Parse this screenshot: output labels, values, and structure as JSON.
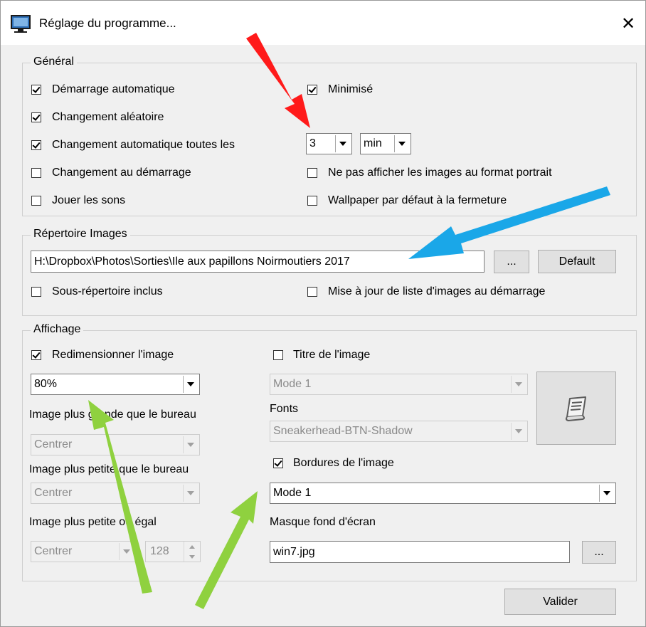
{
  "window": {
    "title": "Réglage du programme...",
    "icon": "monitor-icon",
    "close_glyph": "✕"
  },
  "general": {
    "legend": "Général",
    "auto_start": {
      "label": "Démarrage automatique",
      "checked": true
    },
    "minimized": {
      "label": "Minimisé",
      "checked": true
    },
    "random_change": {
      "label": "Changement aléatoire",
      "checked": true
    },
    "auto_change": {
      "label": "Changement automatique toutes les",
      "checked": true
    },
    "interval_value": "3",
    "interval_unit": "min",
    "change_on_start": {
      "label": "Changement au démarrage",
      "checked": false
    },
    "no_portrait": {
      "label": "Ne pas afficher les images au format portrait",
      "checked": false
    },
    "play_sounds": {
      "label": "Jouer les sons",
      "checked": false
    },
    "default_wallpaper": {
      "label": "Wallpaper par défaut à la fermeture",
      "checked": false
    }
  },
  "images_dir": {
    "legend": "Répertoire Images",
    "path": "H:\\Dropbox\\Photos\\Sorties\\Ile aux papillons Noirmoutiers 2017",
    "browse_label": "...",
    "default_label": "Default",
    "include_subdirs": {
      "label": "Sous-répertoire inclus",
      "checked": false
    },
    "refresh_on_start": {
      "label": "Mise à jour de liste d'images au démarrage",
      "checked": false
    }
  },
  "display": {
    "legend": "Affichage",
    "resize": {
      "label": "Redimensionner l'image",
      "checked": true
    },
    "resize_value": "80%",
    "larger_label": "Image plus grande que le bureau",
    "larger_value": "Centrer",
    "smaller_label": "Image plus petite que le bureau",
    "smaller_value": "Centrer",
    "equal_label": "Image plus petite ou égal",
    "equal_value": "Centrer",
    "equal_size": "128",
    "image_title": {
      "label": "Titre de l'image",
      "checked": false
    },
    "title_mode": "Mode 1",
    "fonts_label": "Fonts",
    "font_value": "Sneakerhead-BTN-Shadow",
    "borders": {
      "label": "Bordures de l'image",
      "checked": true
    },
    "border_mode": "Mode 1",
    "mask_label": "Masque fond d'écran",
    "mask_value": "win7.jpg",
    "mask_browse_label": "...",
    "script_button_icon": "scroll-icon"
  },
  "footer": {
    "validate_label": "Valider"
  },
  "colors": {
    "arrow_red": "#ff1a1a",
    "arrow_blue": "#1aa7e8",
    "arrow_green": "#8fd13f"
  }
}
